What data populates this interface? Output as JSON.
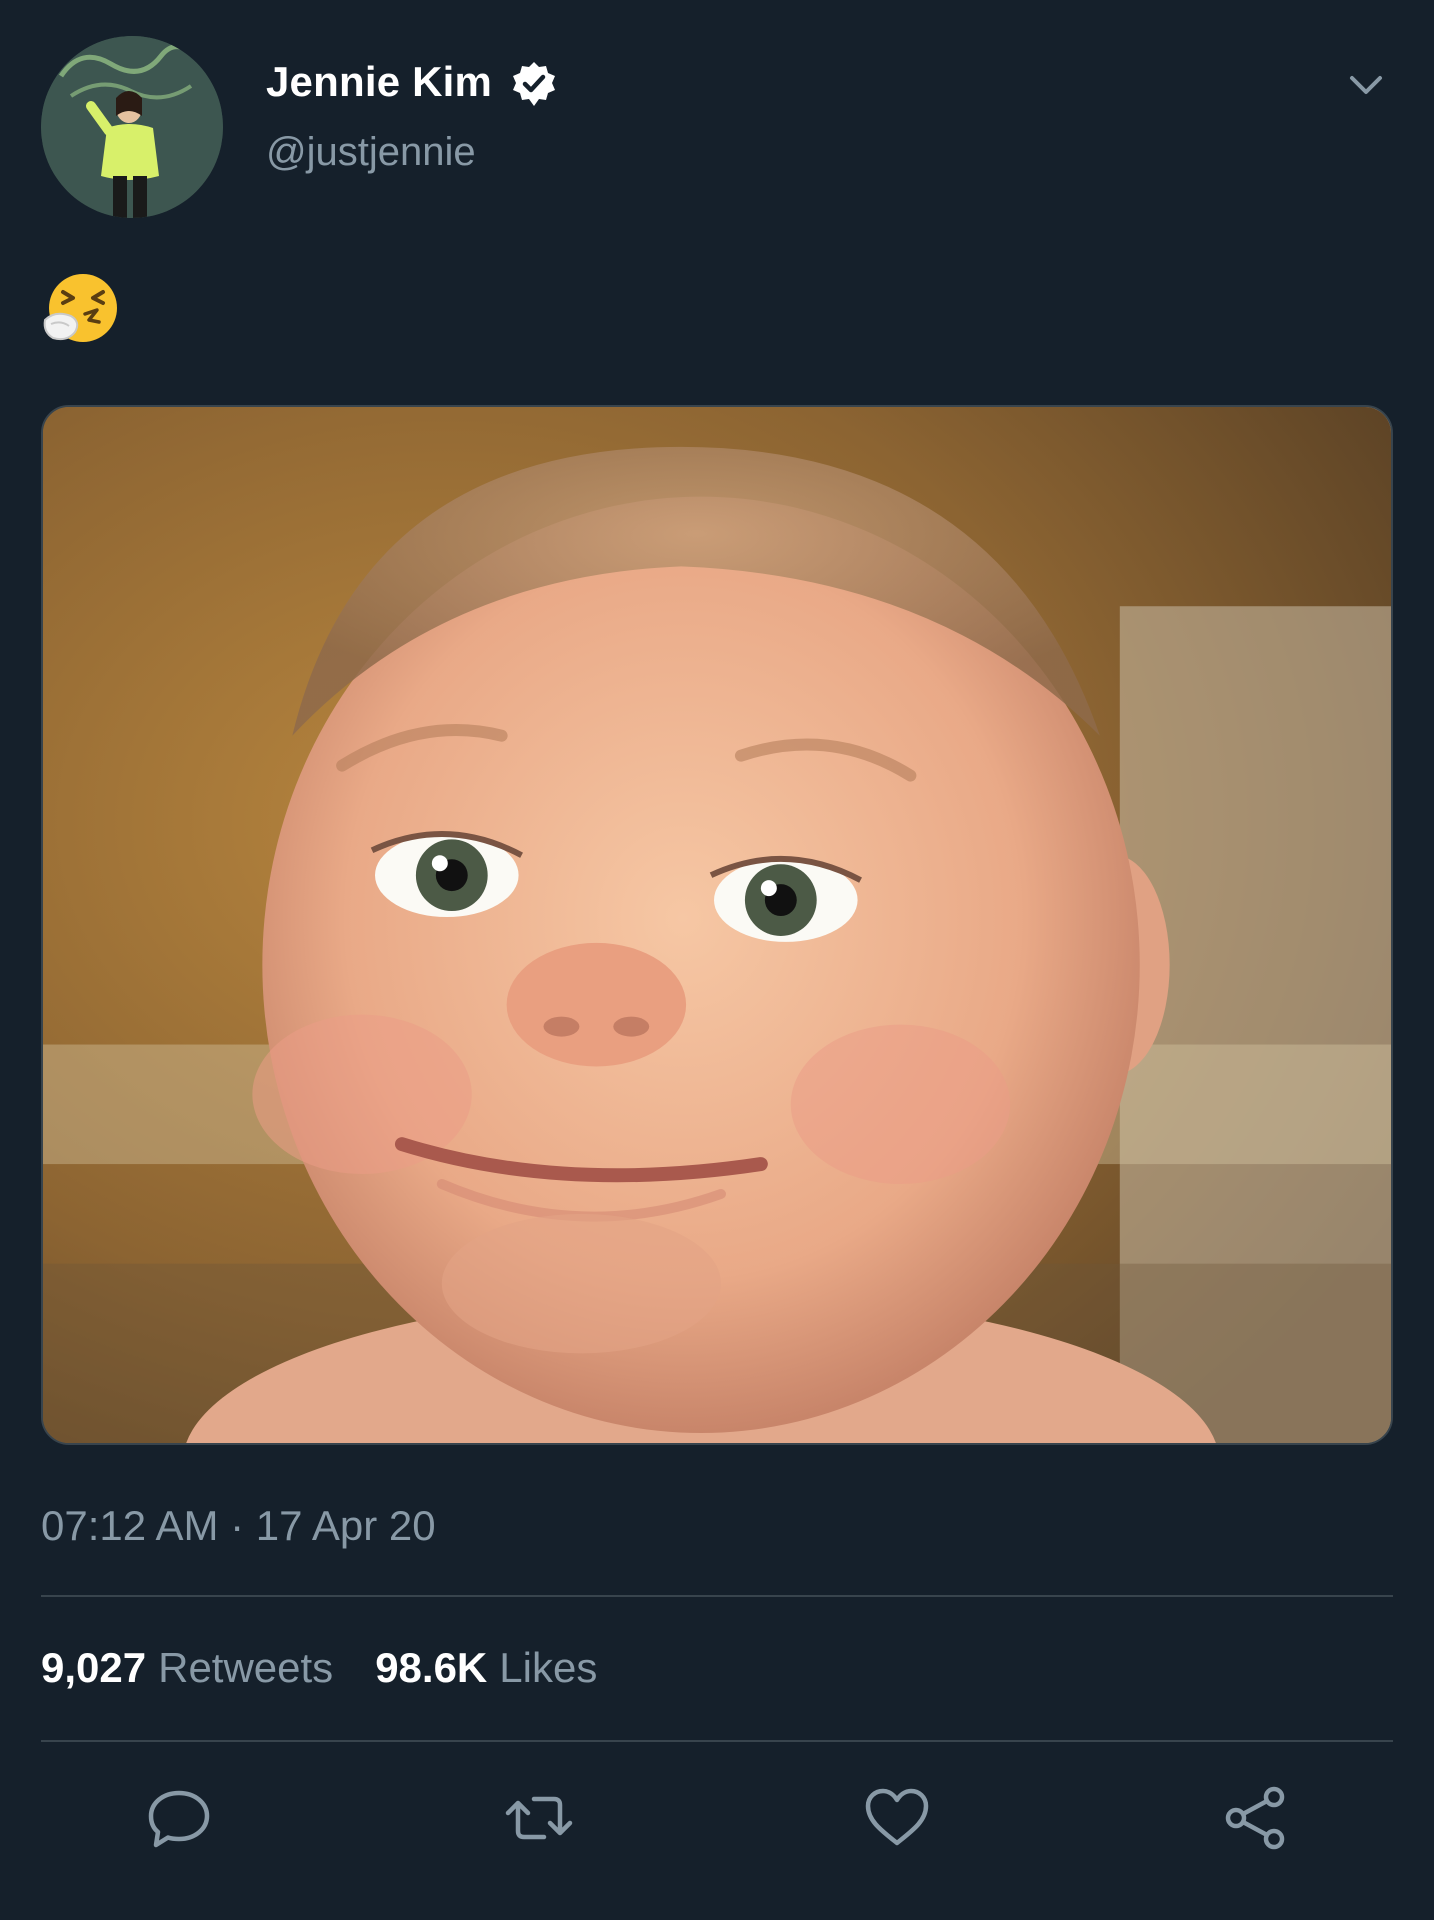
{
  "user": {
    "display_name": "Jennie Kim",
    "handle": "@justjennie",
    "verified": true
  },
  "tweet": {
    "text": "🤧",
    "emoji_name": "sneezing-face-icon",
    "media_description_icon": "photo"
  },
  "meta": {
    "timestamp": "07:12 AM · 17 Apr 20"
  },
  "stats": {
    "retweets_count": "9,027",
    "retweets_label": "Retweets",
    "likes_count": "98.6K",
    "likes_label": "Likes"
  },
  "actions": {
    "reply_icon": "reply-icon",
    "retweet_icon": "retweet-icon",
    "like_icon": "heart-icon",
    "share_icon": "share-icon"
  },
  "colors": {
    "background": "#15202b",
    "text_primary": "#ffffff",
    "text_secondary": "#8899a6",
    "divider": "#38444d"
  }
}
